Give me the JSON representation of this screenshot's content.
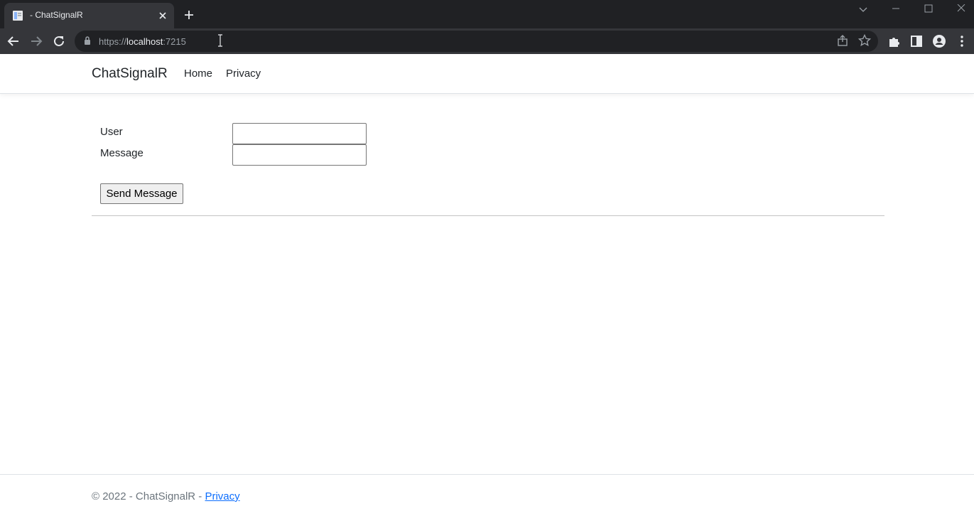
{
  "browser": {
    "tab_title": "- ChatSignalR",
    "url_prefix": "https://",
    "url_host": "localhost",
    "url_suffix": ":7215"
  },
  "navbar": {
    "brand": "ChatSignalR",
    "links": [
      {
        "label": "Home"
      },
      {
        "label": "Privacy"
      }
    ]
  },
  "form": {
    "user_label": "User",
    "user_value": "",
    "message_label": "Message",
    "message_value": "",
    "send_label": "Send Message"
  },
  "footer": {
    "text": "© 2022 - ChatSignalR - ",
    "link": "Privacy"
  },
  "colors": {
    "link": "#0d6efd",
    "chrome_dark": "#202124",
    "chrome_toolbar": "#35363a"
  }
}
